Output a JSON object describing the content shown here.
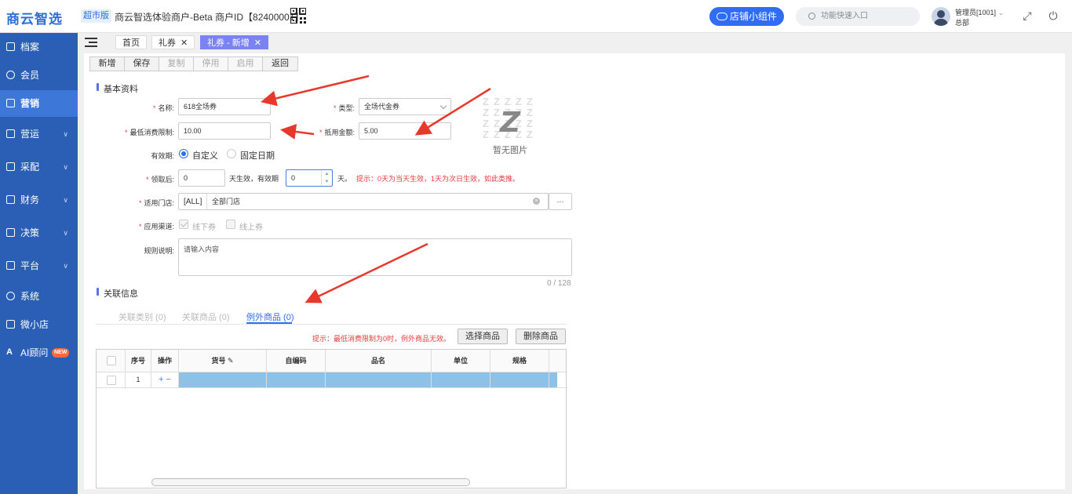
{
  "header": {
    "logo": "商云智选",
    "edition": "超市版",
    "merchant": "商云智选体验商户-Beta  商户ID【82400001】",
    "widget_button": "店铺小组件",
    "quick_search_placeholder": "功能快速入口",
    "user_name": "管理员[1001]",
    "user_dept": "总部"
  },
  "sidebar": {
    "items": [
      {
        "label": "档案",
        "icon": "archive-icon",
        "active": false
      },
      {
        "label": "会员",
        "icon": "user-icon",
        "active": false
      },
      {
        "label": "营销",
        "icon": "shop-icon",
        "active": true
      },
      {
        "label": "营运",
        "icon": "store-icon",
        "active": false,
        "expandable": true
      },
      {
        "label": "采配",
        "icon": "truck-icon",
        "active": false,
        "expandable": true
      },
      {
        "label": "财务",
        "icon": "finance-icon",
        "active": false,
        "expandable": true
      },
      {
        "label": "决策",
        "icon": "chart-icon",
        "active": false,
        "expandable": true
      },
      {
        "label": "平台",
        "icon": "monitor-icon",
        "active": false,
        "expandable": true
      },
      {
        "label": "系统",
        "icon": "settings-icon",
        "active": false
      },
      {
        "label": "微小店",
        "icon": "mini-shop-icon",
        "active": false
      },
      {
        "label": "AI顾问",
        "icon": "ai-icon",
        "active": false,
        "badge": "NEW"
      }
    ]
  },
  "tabs": [
    {
      "label": "首页",
      "closable": false
    },
    {
      "label": "礼券",
      "closable": true
    },
    {
      "label": "礼券 - 新增",
      "closable": true,
      "active": true
    }
  ],
  "toolbar": {
    "new": "新增",
    "save": "保存",
    "copy": "复制",
    "disable": "停用",
    "enable": "启用",
    "back": "返回"
  },
  "basic": {
    "section_title": "基本资料",
    "name_label": "名称:",
    "name_value": "618全场券",
    "type_label": "类型:",
    "type_value": "全场代金券",
    "min_label": "最低消费限制:",
    "min_value": "10.00",
    "deduct_label": "抵用金额:",
    "deduct_value": "5.00",
    "validity_label": "有效期:",
    "validity_custom": "自定义",
    "validity_fixed": "固定日期",
    "after_label": "领取后:",
    "after_value": "0",
    "after_text": "天生效，有效期",
    "valid_days_value": "0",
    "days_unit": "天。",
    "after_hint": "提示：0天为当天生效，1天为次日生效，如此类推。",
    "store_label": "适用门店:",
    "store_code": "[ALL]",
    "store_name": "全部门店",
    "store_more": "···",
    "channel_label": "应用渠道:",
    "channel_offline": "线下券",
    "channel_online": "线上券",
    "rule_label": "规则说明:",
    "rule_placeholder": "请输入内容",
    "rule_counter": "0 / 128",
    "no_image": "暂无图片"
  },
  "related": {
    "section_title": "关联信息",
    "tabs": [
      "关联类别 (0)",
      "关联商品 (0)",
      "例外商品 (0)"
    ],
    "active_tab": 2,
    "hint": "提示：最低消费限制为0时，例外商品无效。",
    "select_button": "选择商品",
    "delete_button": "删除商品",
    "columns": [
      "序号",
      "操作",
      "货号",
      "自编码",
      "品名",
      "单位",
      "规格"
    ],
    "rows": [
      {
        "index": "1",
        "op": "+ −"
      }
    ]
  },
  "colors": {
    "sidebar": "#2a5fb5",
    "accent": "#2f6df6",
    "active_tab": "#7b83f0",
    "required": "#e63c3c",
    "row_selected": "#8ec1e6",
    "annotation_arrow": "#e8382c"
  }
}
